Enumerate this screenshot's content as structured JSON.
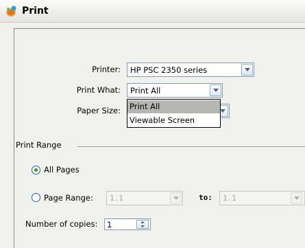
{
  "window": {
    "title": "Print"
  },
  "printer": {
    "label": "Printer:",
    "value": "HP PSC 2350 series"
  },
  "print_what": {
    "label": "Print What:",
    "value": "Print All",
    "options": [
      "Print All",
      "Viewable Screen"
    ]
  },
  "paper_size": {
    "label": "Paper Size:"
  },
  "print_range": {
    "title": "Print Range",
    "all_pages_label": "All Pages",
    "page_range_label": "Page Range:",
    "from_value": "1.1",
    "to_label": "to:",
    "to_value": "1.1"
  },
  "copies": {
    "label": "Number of copies:",
    "value": "1"
  },
  "colors": {
    "radio_dot": "#21a121",
    "selection": "#b6b6b4"
  }
}
